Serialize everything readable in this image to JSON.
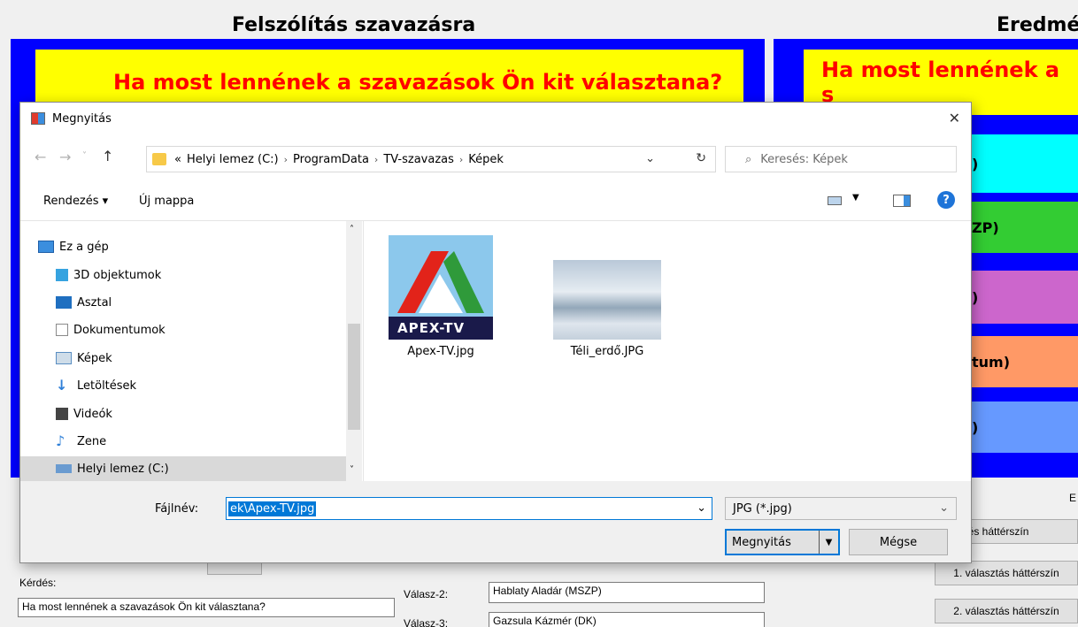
{
  "left_panel": {
    "title": "Felszólítás szavazásra",
    "question_banner": "Ha most lennének a szavazások Ön kit választana?"
  },
  "right_panel": {
    "title": "Eredmé",
    "question_banner": "Ha most lennének a s",
    "bars": [
      {
        "text": ")",
        "color": "#00ffff"
      },
      {
        "text": "ZP)",
        "color": "#33cc33"
      },
      {
        "text": ")",
        "color": "#cc66cc"
      },
      {
        "text": "tum)",
        "color": "#ff9966"
      },
      {
        "text": ")",
        "color": "#6699ff"
      }
    ],
    "right_label": "E",
    "buttons": [
      "rdés háttérszín",
      "1. válasz­tás háttérszín",
      "2. választás háttérszín"
    ]
  },
  "form": {
    "question_label": "Kérdés:",
    "question_value": "Ha most lennének a szavazások Ön kit választana?",
    "answer2_label": "Válasz-2:",
    "answer2_value": "Hablaty Aladár (MSZP)",
    "answer3_label": "Válasz-3:",
    "answer3_value": "Gazsula Kázmér (DK)"
  },
  "dialog": {
    "title": "Megnyitás",
    "close": "✕",
    "breadcrumb": [
      "«",
      "Helyi lemez (C:)",
      "ProgramData",
      "TV-szavazas",
      "Képek"
    ],
    "search_placeholder": "Keresés: Képek",
    "organize_label": "Rendezés ▾",
    "new_folder_label": "Új mappa",
    "help": "?",
    "tree": [
      {
        "label": "Ez a gép",
        "icon": "computer-icon",
        "color": "#3b8ede"
      },
      {
        "label": "3D objektumok",
        "icon": "cube-icon",
        "color": "#36a3e0"
      },
      {
        "label": "Asztal",
        "icon": "desktop-icon",
        "color": "#1f6fc0"
      },
      {
        "label": "Dokumentumok",
        "icon": "document-icon",
        "color": "#8a8a8a"
      },
      {
        "label": "Képek",
        "icon": "pictures-icon",
        "color": "#5a8ec2"
      },
      {
        "label": "Letöltések",
        "icon": "download-icon",
        "color": "#2e7fd8"
      },
      {
        "label": "Videók",
        "icon": "video-icon",
        "color": "#444444"
      },
      {
        "label": "Zene",
        "icon": "music-icon",
        "color": "#2e7fd8"
      },
      {
        "label": "Helyi lemez (C:)",
        "icon": "drive-icon",
        "color": "#6a9bd0"
      }
    ],
    "files": [
      {
        "name": "Apex-TV.jpg",
        "logo_text": "APEX-TV"
      },
      {
        "name": "Téli_erdő.JPG"
      }
    ],
    "filename_label": "Fájlnév:",
    "filename_value": "ek\\Apex-TV.jpg",
    "filter_value": "JPG (*.jpg)",
    "open_label": "Megnyitás",
    "cancel_label": "Mégse"
  }
}
